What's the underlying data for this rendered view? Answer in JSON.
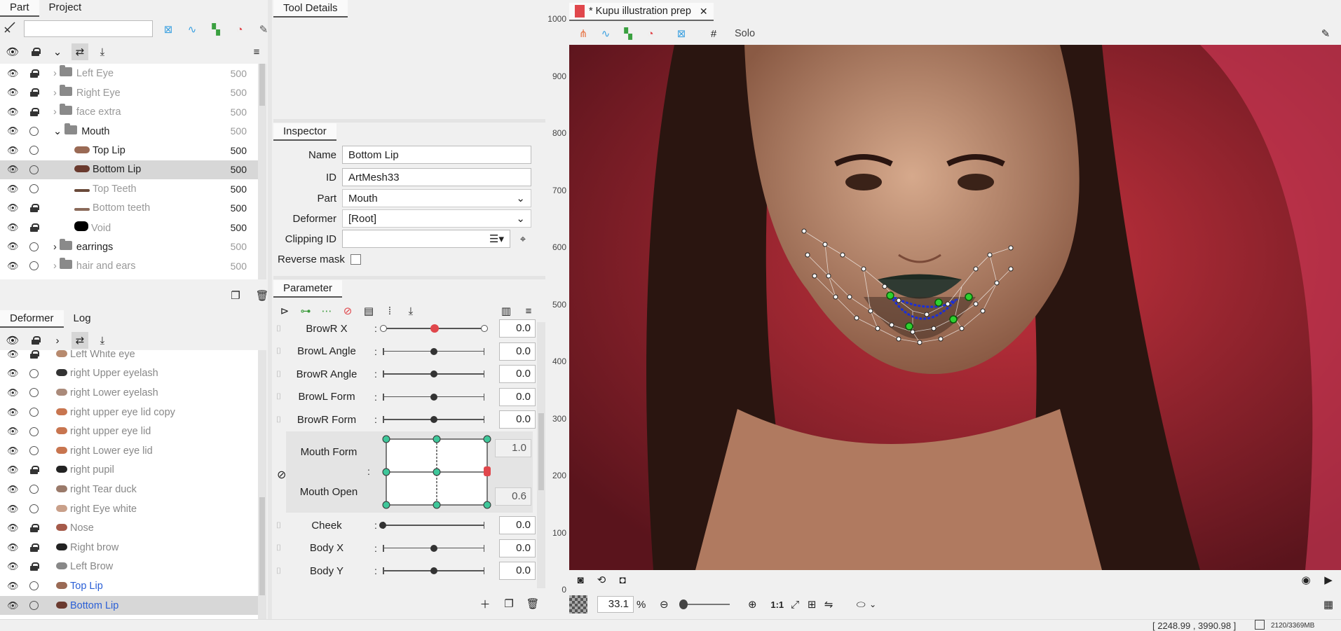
{
  "part_panel": {
    "tabs": [
      "Part",
      "Project"
    ],
    "search_placeholder": "",
    "rows": [
      {
        "label": "Left Eye",
        "value": "500",
        "kind": "folder",
        "locked": true,
        "dim": true
      },
      {
        "label": "Right Eye",
        "value": "500",
        "kind": "folder",
        "locked": true,
        "dim": true
      },
      {
        "label": "face extra",
        "value": "500",
        "kind": "folder",
        "locked": true,
        "dim": true
      },
      {
        "label": "Mouth",
        "value": "500",
        "kind": "folder-open",
        "locked": false,
        "dim": false
      },
      {
        "label": "Top Lip",
        "value": "500",
        "kind": "mesh",
        "locked": false,
        "dim": false
      },
      {
        "label": "Bottom Lip",
        "value": "500",
        "kind": "mesh",
        "locked": false,
        "dim": false,
        "selected": true
      },
      {
        "label": "Top Teeth",
        "value": "500",
        "kind": "mesh",
        "locked": false,
        "dim": true
      },
      {
        "label": "Bottom teeth",
        "value": "500",
        "kind": "mesh",
        "locked": true,
        "dim": true
      },
      {
        "label": "Void",
        "value": "500",
        "kind": "mesh",
        "locked": true,
        "dim": true
      },
      {
        "label": "earrings",
        "value": "500",
        "kind": "folder",
        "locked": false,
        "dim": false
      },
      {
        "label": "hair and ears",
        "value": "500",
        "kind": "folder",
        "locked": false,
        "dim": true
      }
    ]
  },
  "deformer_panel": {
    "tabs": [
      "Deformer",
      "Log"
    ],
    "rows": [
      {
        "label": "Left White eye",
        "locked": true,
        "blue": false
      },
      {
        "label": "right Upper eyelash",
        "locked": false,
        "blue": false
      },
      {
        "label": "right Lower eyelash",
        "locked": false,
        "blue": false
      },
      {
        "label": "right upper eye lid copy",
        "locked": false,
        "blue": false
      },
      {
        "label": "right upper eye lid",
        "locked": false,
        "blue": false
      },
      {
        "label": "right Lower eye lid",
        "locked": false,
        "blue": false
      },
      {
        "label": "right pupil",
        "locked": true,
        "blue": false
      },
      {
        "label": "right Tear duck",
        "locked": false,
        "blue": false
      },
      {
        "label": "right Eye white",
        "locked": false,
        "blue": false
      },
      {
        "label": "Nose",
        "locked": true,
        "blue": false
      },
      {
        "label": "Right brow",
        "locked": true,
        "blue": false
      },
      {
        "label": "Left Brow",
        "locked": true,
        "blue": false
      },
      {
        "label": "Top Lip",
        "locked": false,
        "blue": true
      },
      {
        "label": "Bottom Lip",
        "locked": false,
        "blue": true,
        "selected": true
      }
    ]
  },
  "tool_details": {
    "tab": "Tool Details"
  },
  "inspector": {
    "tab": "Inspector",
    "name_label": "Name",
    "name_value": "Bottom Lip",
    "id_label": "ID",
    "id_value": "ArtMesh33",
    "part_label": "Part",
    "part_value": "Mouth",
    "deformer_label": "Deformer",
    "deformer_value": "[Root]",
    "clipping_label": "Clipping ID",
    "clipping_value": "",
    "reverse_mask_label": "Reverse mask"
  },
  "parameter": {
    "tab": "Parameter",
    "items": [
      {
        "label": "BrowR X",
        "value": "0.0",
        "pos": 0.5,
        "active": true
      },
      {
        "label": "BrowL Angle",
        "value": "0.0",
        "pos": 0.5
      },
      {
        "label": "BrowR Angle",
        "value": "0.0",
        "pos": 0.5
      },
      {
        "label": "BrowL Form",
        "value": "0.0",
        "pos": 0.5
      },
      {
        "label": "BrowR Form",
        "value": "0.0",
        "pos": 0.5
      }
    ],
    "grid": {
      "label_a": "Mouth Form",
      "value_a": "1.0",
      "label_b": "Mouth Open",
      "value_b": "0.6"
    },
    "items2": [
      {
        "label": "Cheek",
        "value": "0.0",
        "pos": 0.0
      },
      {
        "label": "Body X",
        "value": "0.0",
        "pos": 0.5
      },
      {
        "label": "Body Y",
        "value": "0.0",
        "pos": 0.5
      }
    ]
  },
  "viewport": {
    "doc_tab": "* Kupu illustration prep",
    "solo_label": "Solo",
    "zoom_value": "33.1",
    "zoom_unit": "%",
    "one_to_one": "1:1",
    "ruler_ticks": [
      "1000",
      "900",
      "800",
      "700",
      "600",
      "500",
      "400",
      "300",
      "200",
      "100",
      "0"
    ]
  },
  "status": {
    "coords": "[ 2248.99 , 3990.98 ]",
    "memory": "2120/3369MB"
  },
  "colors": {
    "accent_green": "#2fd02f",
    "mesh_blue": "#1a2fd8",
    "selection": "#d7d7d7",
    "warning_red": "#e0474c"
  }
}
